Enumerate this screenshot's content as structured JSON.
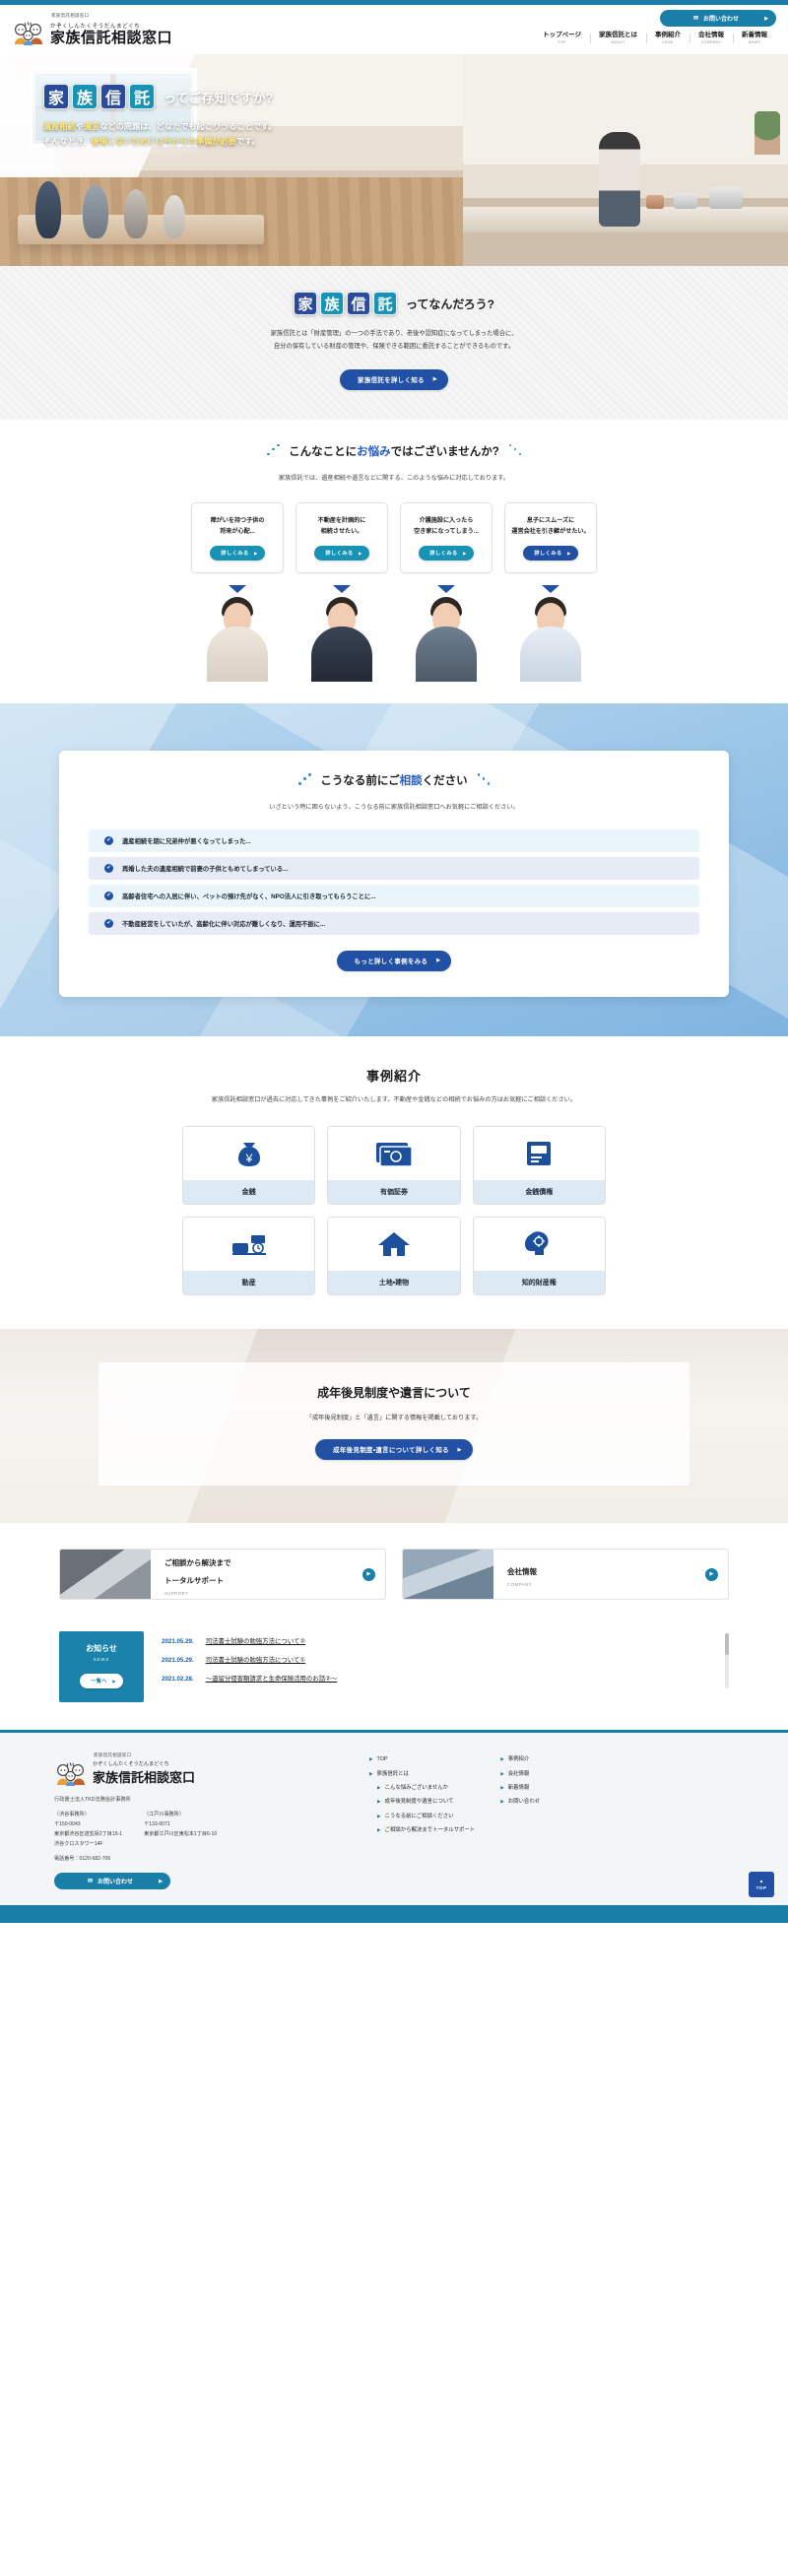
{
  "site": {
    "micro_label": "家族信託相談窓口",
    "kana": "かぞくしんたくそうだんまどぐち",
    "name": "家族信託相談窓口"
  },
  "header": {
    "contact_button": "お問い合わせ",
    "contact_icon": "mail-icon",
    "nav": [
      {
        "ja": "トップページ",
        "en": "TOP"
      },
      {
        "ja": "家族信託とは",
        "en": "ABOUT"
      },
      {
        "ja": "事例紹介",
        "en": "CASE"
      },
      {
        "ja": "会社情報",
        "en": "COMPANY"
      },
      {
        "ja": "新着情報",
        "en": "NEWS"
      }
    ]
  },
  "hero": {
    "kanji": [
      "家",
      "族",
      "信",
      "託"
    ],
    "tail": "ってご存知ですか?",
    "line1_a": "遺産相続",
    "line1_b": "や",
    "line1_c": "遺言",
    "line1_d": "などの問題は、どなたでも起こりうることです。",
    "line2_a": "そんなとき、",
    "line2_b": "後悔しないためには今からの準備が必要",
    "line2_c": "です。"
  },
  "what_section": {
    "kanji": [
      "家",
      "族",
      "信",
      "託"
    ],
    "tail": "ってなんだろう?",
    "body_line1": "家族信託とは「財産管理」の一つの手法であり、老後や認知症になってしまった場合に、",
    "body_line2": "自分の保有している財産の管理や、保険できる範囲に委託することができるものです。",
    "button": "家族信託を詳しく知る",
    "button_arrow": "▶"
  },
  "worry_section": {
    "title_a": "こんなことに",
    "title_b": "お悩み",
    "title_c": "ではございませんか?",
    "lead": "家族信託では、遺産相続や遺言などに関する、このような悩みに対応しております。",
    "cards": [
      {
        "text_line1": "障がいを持つ子供の",
        "text_line2": "将来が心配...",
        "button": "詳しくみる",
        "tone": "teal"
      },
      {
        "text_line1": "不動産を計画的に",
        "text_line2": "相続させたい。",
        "button": "詳しくみる",
        "tone": "teal"
      },
      {
        "text_line1": "介護施設に入ったら",
        "text_line2": "空き家になってしまう...",
        "button": "詳しくみる",
        "tone": "teal"
      },
      {
        "text_line1": "息子にスムーズに",
        "text_line2": "運営会社を引き継がせたい。",
        "button": "詳しくみる",
        "tone": "navy"
      }
    ]
  },
  "before_section": {
    "title_a": "こうなる前にご",
    "title_b": "相談",
    "title_c": "ください",
    "lead": "いざという時に困らないよう、こうなる前に家族信託相談窓口へお気軽にご相談ください。",
    "cases": [
      "遺産相続を期に兄弟仲が悪くなってしまった...",
      "再婚した夫の遺産相続で前妻の子供ともめてしまっている...",
      "高齢者住宅への入居に伴い、ペットの預け先がなく、NPO法人に引き取ってもらうことに...",
      "不動産経営をしていたが、高齢化に伴い対応が難しくなり、運用不振に..."
    ],
    "button": "もっと詳しく事例をみる",
    "button_arrow": "▶",
    "check_icon": "check-circle-icon"
  },
  "cases_section": {
    "title": "事例紹介",
    "lead": "家族信託相談窓口が過去に対応してきた事例をご紹介いたします。不動産や金銭などの相続でお悩みの方はお気軽にご相談ください。",
    "items": [
      {
        "label": "金銭",
        "icon": "money-bag-icon"
      },
      {
        "label": "有価証券",
        "icon": "certificate-icon"
      },
      {
        "label": "金銭債権",
        "icon": "passbook-icon"
      },
      {
        "label": "動産",
        "icon": "furniture-icon"
      },
      {
        "label": "土地・建物",
        "icon": "house-icon"
      },
      {
        "label": "知的財産権",
        "icon": "brain-gear-icon"
      }
    ]
  },
  "guardian_section": {
    "title": "成年後見制度や遺言について",
    "body": "「成年後見制度」と「遺言」に関する情報を掲載しております。",
    "button": "成年後見制度・遺言について詳しく知る",
    "button_arrow": "▶"
  },
  "banners": [
    {
      "ja_line1": "ご相談から解決まで",
      "ja_line2": "トータルサポート",
      "en": "SUPPORT",
      "arrow": "▶",
      "thumb": "consulting-photo"
    },
    {
      "ja_line1": "会社情報",
      "ja_line2": "",
      "en": "COMPANY",
      "arrow": "▶",
      "thumb": "building-photo"
    }
  ],
  "news": {
    "heading_ja": "お知らせ",
    "heading_en": "NEWS",
    "more_button": "一覧へ",
    "more_arrow": "▶",
    "items": [
      {
        "date": "2021.05.29.",
        "title": "司法書士試験の勉強方法について②"
      },
      {
        "date": "2021.05.29.",
        "title": "司法書士試験の勉強方法について①"
      },
      {
        "date": "2021.02.28.",
        "title": "～遺留分侵害額請求と生命保険活用のお話②～"
      }
    ]
  },
  "footer": {
    "kana": "かぞくしんたくそうだんまどぐち",
    "name": "家族信託相談窓口",
    "corp": "行政書士法人TKD法務会計事務所",
    "offices": [
      {
        "name": "〈渋谷事務所〉",
        "zip": "〒150-0043",
        "address": "東京都渋谷区道玄坂2丁目15-1",
        "address2": "渋谷クロスタワー14F"
      },
      {
        "name": "〈江戸川事務所〉",
        "zip": "〒133-0071",
        "address": "東京都江戸川区東松本1丁目6-10",
        "address2": ""
      }
    ],
    "tel_label": "電話番号：",
    "tel": "0120-682-706",
    "contact_button": "お問い合わせ",
    "contact_icon": "mail-icon",
    "links_col1": [
      {
        "label": "TOP",
        "sub": false
      },
      {
        "label": "家族信託とは",
        "sub": false
      },
      {
        "label": "こんな悩みございませんか",
        "sub": true
      },
      {
        "label": "成年後見制度や遺言について",
        "sub": true
      },
      {
        "label": "こうなる前にご相談ください",
        "sub": true
      },
      {
        "label": "ご相談から解決までトータルサポート",
        "sub": true
      }
    ],
    "links_col2": [
      {
        "label": "事例紹介",
        "sub": false
      },
      {
        "label": "会社情報",
        "sub": false
      },
      {
        "label": "新着情報",
        "sub": false
      },
      {
        "label": "お問い合わせ",
        "sub": false
      }
    ],
    "to_top_label": "TOP",
    "to_top_icon": "arrow-up-icon"
  }
}
